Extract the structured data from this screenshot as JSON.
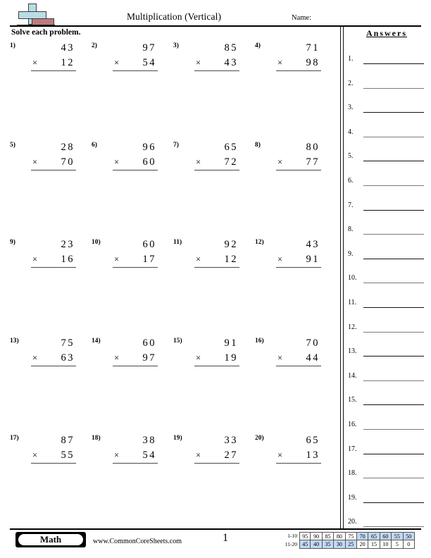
{
  "header": {
    "title": "Multiplication (Vertical)",
    "name_label": "Name:",
    "logo_name": "commoncoresheets-logo"
  },
  "instructions": "Solve each problem.",
  "answers_panel": {
    "title": "Answers",
    "rows": [
      {
        "num": "1."
      },
      {
        "num": "2."
      },
      {
        "num": "3."
      },
      {
        "num": "4."
      },
      {
        "num": "5."
      },
      {
        "num": "6."
      },
      {
        "num": "7."
      },
      {
        "num": "8."
      },
      {
        "num": "9."
      },
      {
        "num": "10."
      },
      {
        "num": "11."
      },
      {
        "num": "12."
      },
      {
        "num": "13."
      },
      {
        "num": "14."
      },
      {
        "num": "15."
      },
      {
        "num": "16."
      },
      {
        "num": "17."
      },
      {
        "num": "18."
      },
      {
        "num": "19."
      },
      {
        "num": "20."
      }
    ]
  },
  "problems": [
    {
      "num": "1)",
      "top": "43",
      "op": "×",
      "bottom": "12"
    },
    {
      "num": "2)",
      "top": "97",
      "op": "×",
      "bottom": "54"
    },
    {
      "num": "3)",
      "top": "85",
      "op": "×",
      "bottom": "43"
    },
    {
      "num": "4)",
      "top": "71",
      "op": "×",
      "bottom": "98"
    },
    {
      "num": "5)",
      "top": "28",
      "op": "×",
      "bottom": "70"
    },
    {
      "num": "6)",
      "top": "96",
      "op": "×",
      "bottom": "60"
    },
    {
      "num": "7)",
      "top": "65",
      "op": "×",
      "bottom": "72"
    },
    {
      "num": "8)",
      "top": "80",
      "op": "×",
      "bottom": "77"
    },
    {
      "num": "9)",
      "top": "23",
      "op": "×",
      "bottom": "16"
    },
    {
      "num": "10)",
      "top": "60",
      "op": "×",
      "bottom": "17"
    },
    {
      "num": "11)",
      "top": "92",
      "op": "×",
      "bottom": "12"
    },
    {
      "num": "12)",
      "top": "43",
      "op": "×",
      "bottom": "91"
    },
    {
      "num": "13)",
      "top": "75",
      "op": "×",
      "bottom": "63"
    },
    {
      "num": "14)",
      "top": "60",
      "op": "×",
      "bottom": "97"
    },
    {
      "num": "15)",
      "top": "91",
      "op": "×",
      "bottom": "19"
    },
    {
      "num": "16)",
      "top": "70",
      "op": "×",
      "bottom": "44"
    },
    {
      "num": "17)",
      "top": "87",
      "op": "×",
      "bottom": "55"
    },
    {
      "num": "18)",
      "top": "38",
      "op": "×",
      "bottom": "54"
    },
    {
      "num": "19)",
      "top": "33",
      "op": "×",
      "bottom": "27"
    },
    {
      "num": "20)",
      "top": "65",
      "op": "×",
      "bottom": "13"
    }
  ],
  "footer": {
    "subject_badge": "Math",
    "site_url": "www.CommonCoreSheets.com",
    "page_number": "1"
  },
  "grade_scale": {
    "row1_label": "1-10",
    "row2_label": "11-20",
    "row1": [
      {
        "v": "95",
        "hi": false
      },
      {
        "v": "90",
        "hi": false
      },
      {
        "v": "85",
        "hi": false
      },
      {
        "v": "80",
        "hi": false
      },
      {
        "v": "75",
        "hi": false
      },
      {
        "v": "70",
        "hi": true
      },
      {
        "v": "65",
        "hi": true
      },
      {
        "v": "60",
        "hi": true
      },
      {
        "v": "55",
        "hi": true
      },
      {
        "v": "50",
        "hi": true
      }
    ],
    "row2": [
      {
        "v": "45",
        "hi": true
      },
      {
        "v": "40",
        "hi": true
      },
      {
        "v": "35",
        "hi": true
      },
      {
        "v": "30",
        "hi": true
      },
      {
        "v": "25",
        "hi": true
      },
      {
        "v": "20",
        "hi": false
      },
      {
        "v": "15",
        "hi": false
      },
      {
        "v": "10",
        "hi": false
      },
      {
        "v": "5",
        "hi": false
      },
      {
        "v": "0",
        "hi": false
      }
    ],
    "highlight_color": "#c2d9f2"
  }
}
